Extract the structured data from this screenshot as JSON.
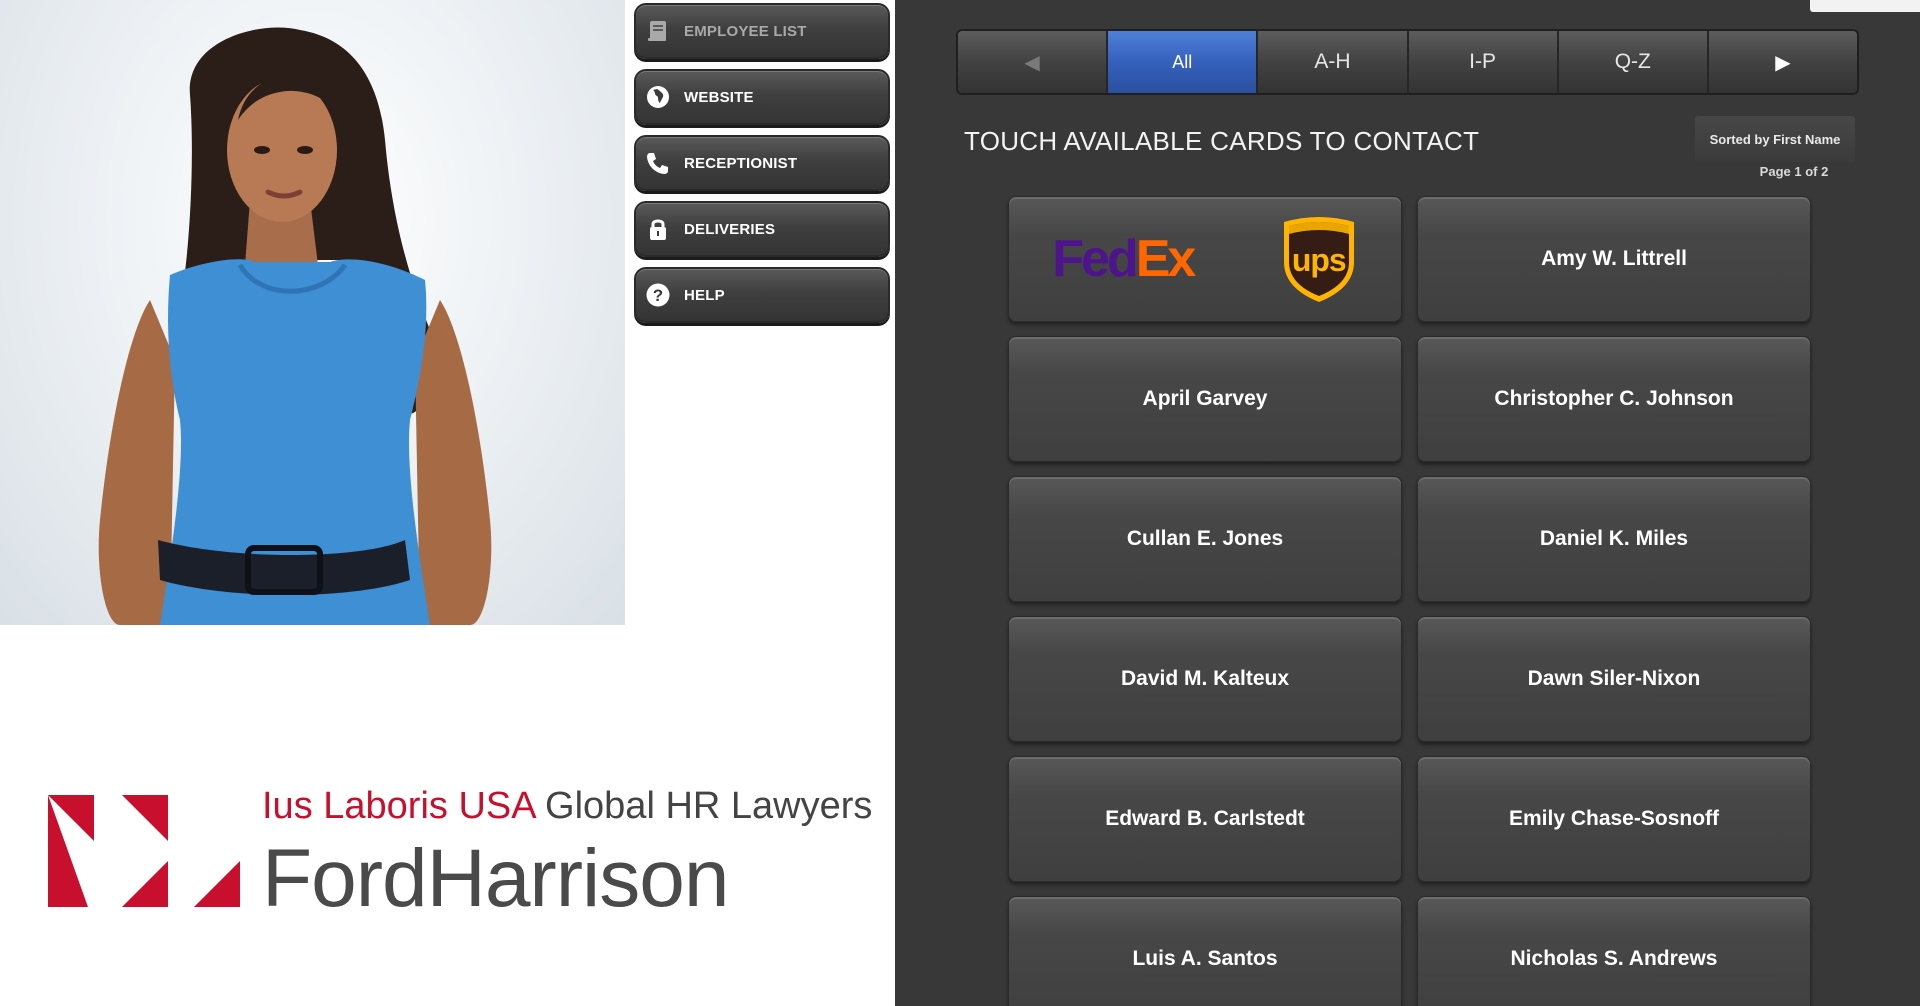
{
  "nav": {
    "items": [
      {
        "label": "EMPLOYEE LIST",
        "icon": "book-icon",
        "disabled": true
      },
      {
        "label": "WEBSITE",
        "icon": "globe-icon",
        "disabled": false
      },
      {
        "label": "RECEPTIONIST",
        "icon": "phone-icon",
        "disabled": false
      },
      {
        "label": "DELIVERIES",
        "icon": "lock-icon",
        "disabled": false
      },
      {
        "label": "HELP",
        "icon": "help-icon",
        "disabled": false
      }
    ]
  },
  "logo": {
    "tagline_red": "Ius Laboris USA",
    "tagline_gray": " Global HR Lawyers",
    "brand": "FordHarrison",
    "brand_color": "#c8102e"
  },
  "directory": {
    "tabs": [
      {
        "label": "All",
        "active": true
      },
      {
        "label": "A-H",
        "active": false
      },
      {
        "label": "I-P",
        "active": false
      },
      {
        "label": "Q-Z",
        "active": false
      }
    ],
    "heading": "TOUCH AVAILABLE CARDS TO CONTACT",
    "sort_label": "Sorted by First Name",
    "page_indicator": "Page 1 of 2",
    "delivery_card": {
      "fedex_fed": "Fed",
      "fedex_ex": "Ex",
      "ups": "ups"
    },
    "cards": [
      "Amy W. Littrell",
      "April Garvey",
      "Christopher C. Johnson",
      "Cullan E. Jones",
      "Daniel K. Miles",
      "David M. Kalteux",
      "Dawn Siler-Nixon",
      "Edward B. Carlstedt",
      "Emily Chase-Sosnoff",
      "Luis A. Santos",
      "Nicholas S. Andrews"
    ],
    "active_color": "#3561bd"
  }
}
